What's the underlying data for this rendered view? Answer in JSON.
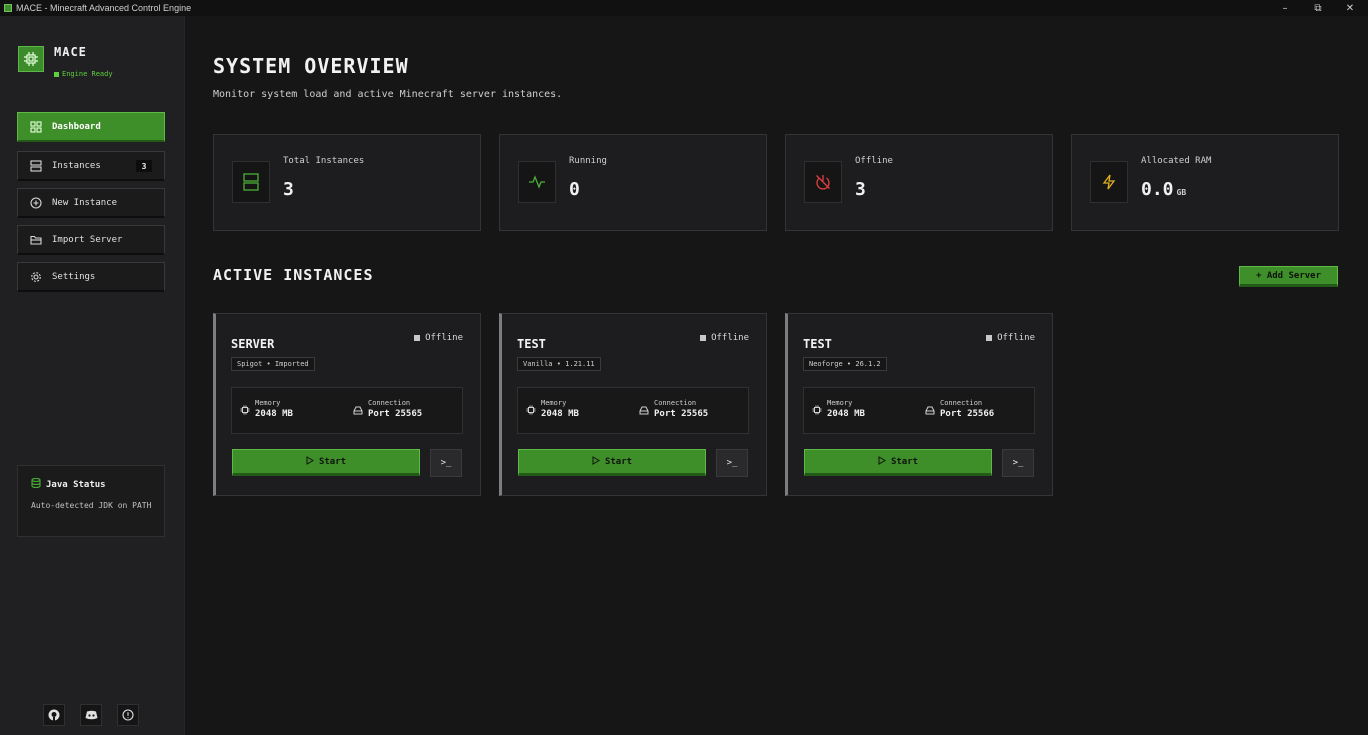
{
  "window": {
    "title": "MACE - Minecraft Advanced Control Engine",
    "minimize": "–",
    "restore": "⧉",
    "close": "✕"
  },
  "sidebar": {
    "brand": "MACE",
    "status": "Engine Ready",
    "nav": [
      {
        "label": "Dashboard",
        "icon": "grid-icon",
        "active": true
      },
      {
        "label": "Instances",
        "icon": "server-icon",
        "badge": "3"
      },
      {
        "label": "New Instance",
        "icon": "plus-circle-icon"
      },
      {
        "label": "Import Server",
        "icon": "folder-icon"
      },
      {
        "label": "Settings",
        "icon": "gear-icon"
      }
    ],
    "java": {
      "title": "Java Status",
      "description": "Auto-detected JDK on PATH"
    },
    "footer_icons": [
      "github-icon",
      "discord-icon",
      "info-icon"
    ]
  },
  "main": {
    "title": "SYSTEM OVERVIEW",
    "subtitle": "Monitor system load and active Minecraft server instances.",
    "stats": [
      {
        "label": "Total Instances",
        "value": "3",
        "unit": "",
        "icon": "server-icon",
        "color": "#4caf35"
      },
      {
        "label": "Running",
        "value": "0",
        "unit": "",
        "icon": "activity-icon",
        "color": "#4caf35"
      },
      {
        "label": "Offline",
        "value": "3",
        "unit": "",
        "icon": "power-off-icon",
        "color": "#e04040"
      },
      {
        "label": "Allocated RAM",
        "value": "0.0",
        "unit": "GB",
        "icon": "lightning-icon",
        "color": "#e0b020"
      }
    ],
    "instances_title": "ACTIVE INSTANCES",
    "add_button": "+ Add Server",
    "instances": [
      {
        "name": "SERVER",
        "tag": "Spigot • Imported",
        "status": "Offline",
        "memory_label": "Memory",
        "memory": "2048 MB",
        "connection_label": "Connection",
        "port": "Port 25565",
        "start_label": "Start",
        "terminal_label": ">_"
      },
      {
        "name": "TEST",
        "tag": "Vanilla • 1.21.11",
        "status": "Offline",
        "memory_label": "Memory",
        "memory": "2048 MB",
        "connection_label": "Connection",
        "port": "Port 25565",
        "start_label": "Start",
        "terminal_label": ">_"
      },
      {
        "name": "TEST",
        "tag": "Neoforge • 26.1.2",
        "status": "Offline",
        "memory_label": "Memory",
        "memory": "2048 MB",
        "connection_label": "Connection",
        "port": "Port 25566",
        "start_label": "Start",
        "terminal_label": ">_"
      }
    ]
  }
}
